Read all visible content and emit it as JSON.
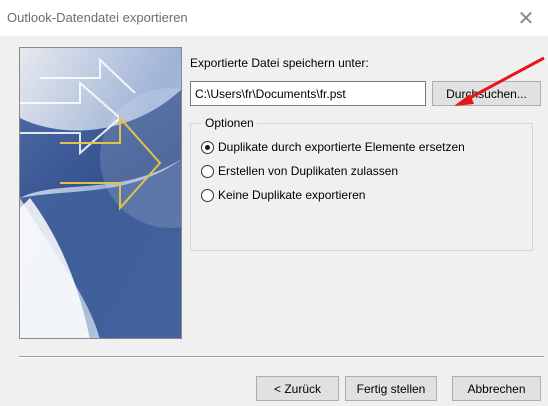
{
  "window": {
    "title": "Outlook-Datendatei exportieren",
    "close_icon": "close-icon"
  },
  "form": {
    "save_label": "Exportierte Datei speichern unter:",
    "file_path": "C:\\Users\\fr\\Documents\\fr.pst",
    "browse_label": "Durchsuchen..."
  },
  "options": {
    "legend": "Optionen",
    "items": [
      {
        "label": "Duplikate durch exportierte Elemente ersetzen",
        "checked": true
      },
      {
        "label": "Erstellen von Duplikaten zulassen",
        "checked": false
      },
      {
        "label": "Keine Duplikate exportieren",
        "checked": false
      }
    ]
  },
  "footer": {
    "back_label": "< Zurück",
    "finish_label": "Fertig stellen",
    "cancel_label": "Abbrechen"
  },
  "annotation": {
    "arrow_color": "#e8141b"
  }
}
